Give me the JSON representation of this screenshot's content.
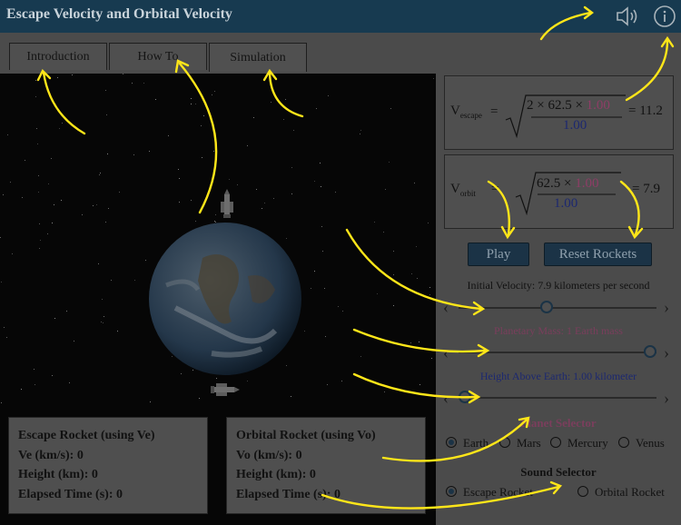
{
  "app": {
    "title": "Escape Velocity and Orbital Velocity"
  },
  "header": {
    "sound_icon": "speaker-icon",
    "info_icon": "info-icon"
  },
  "tabs": [
    {
      "label": "Introduction",
      "active": false
    },
    {
      "label": "How To",
      "active": false
    },
    {
      "label": "Simulation",
      "active": true
    }
  ],
  "formulas": {
    "escape": {
      "symbol": "V",
      "subscript": "escape",
      "numerator_prefix": "2 × 62.5 × ",
      "numerator_value": "1.00",
      "denominator": "1.00",
      "result": "= 11.2"
    },
    "orbit": {
      "symbol": "V",
      "subscript": "orbit",
      "numerator_prefix": "62.5 × ",
      "numerator_value": "1.00",
      "denominator": "1.00",
      "result": "= 7.9"
    }
  },
  "buttons": {
    "play": "Play",
    "reset": "Reset Rockets"
  },
  "sliders": [
    {
      "label": "Initial Velocity: 7.9 kilometers per second",
      "color": "#111111",
      "level": 0.44
    },
    {
      "label": "Planetary Mass: 1 Earth mass",
      "color": "#7a3e5c",
      "level": 1.0
    },
    {
      "label": "Height Above Earth: 1.00 kilometer",
      "color": "#1c2870",
      "level": 0.0
    }
  ],
  "planet_selector": {
    "title": "Planet Selector",
    "options": [
      {
        "label": "Earth",
        "selected": true
      },
      {
        "label": "Mars",
        "selected": false
      },
      {
        "label": "Mercury",
        "selected": false
      },
      {
        "label": "Venus",
        "selected": false
      }
    ]
  },
  "sound_selector": {
    "title": "Sound Selector",
    "options": [
      {
        "label": "Escape Rocket",
        "selected": true
      },
      {
        "label": "Orbital Rocket",
        "selected": false
      }
    ]
  },
  "escape_panel": {
    "title": "Escape Rocket (using Ve)",
    "rows": [
      {
        "label": "Ve (km/s): ",
        "value": "0"
      },
      {
        "label": "Height (km): ",
        "value": "0"
      },
      {
        "label": "Elapsed Time (s): ",
        "value": "0"
      }
    ]
  },
  "orbital_panel": {
    "title": "Orbital Rocket (using Vo)",
    "rows": [
      {
        "label": "Vo (km/s): ",
        "value": "0"
      },
      {
        "label": "Height (km): ",
        "value": "0"
      },
      {
        "label": "Elapsed Time (s): ",
        "value": "0"
      }
    ]
  },
  "colors": {
    "header": "#173a50",
    "annotation": "#ffe619",
    "accent": "#1b3346",
    "mass": "#c0417e",
    "height": "#1c2870"
  }
}
